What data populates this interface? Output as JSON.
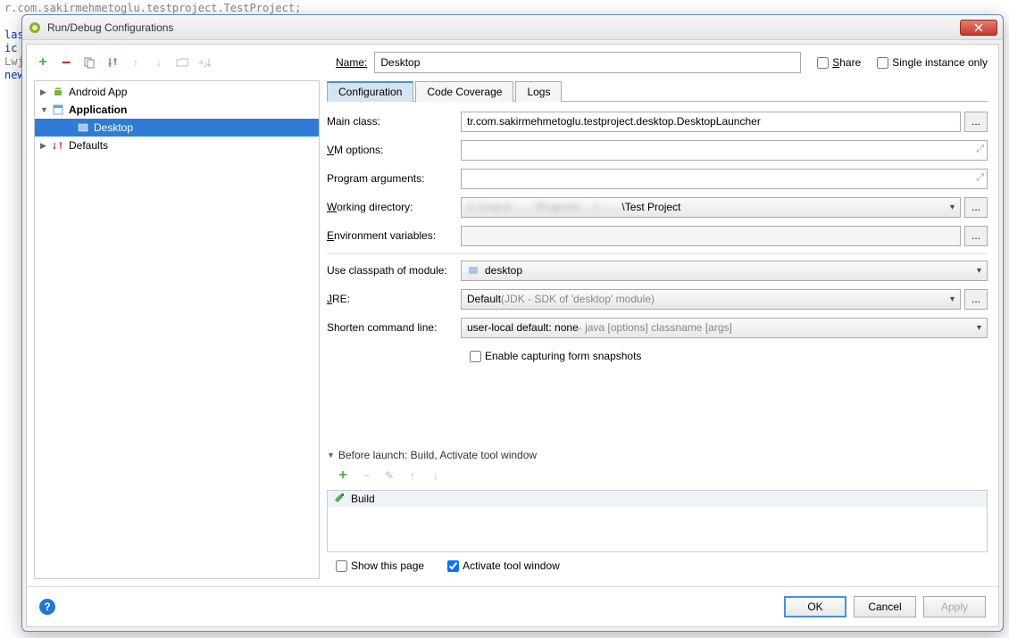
{
  "code_background": {
    "line1": "r.com.sakirmehmetoglu.testproject.TestProject;",
    "line2": "las",
    "line3": "ic",
    "line4": "Lwj",
    "line5": "new"
  },
  "dialog": {
    "title": "Run/Debug Configurations"
  },
  "toolbar": {
    "name_label": "Name:",
    "name_value": "Desktop",
    "share_label": "Share",
    "single_instance_label": "Single instance only"
  },
  "tree": {
    "android_app": "Android App",
    "application": "Application",
    "desktop": "Desktop",
    "defaults": "Defaults"
  },
  "tabs": {
    "configuration": "Configuration",
    "code_coverage": "Code Coverage",
    "logs": "Logs"
  },
  "form": {
    "main_class_label": "Main class:",
    "main_class_value": "tr.com.sakirmehmetoglu.testproject.desktop.DesktopLauncher",
    "vm_options_label": "VM options:",
    "vm_options_value": "",
    "program_args_label": "Program arguments:",
    "program_args_value": "",
    "working_dir_label": "Working directory:",
    "working_dir_value": "\\Test Project",
    "env_vars_label": "Environment variables:",
    "env_vars_value": "",
    "classpath_label": "Use classpath of module:",
    "classpath_value": "desktop",
    "jre_label": "JRE:",
    "jre_value": "Default",
    "jre_hint": " (JDK - SDK of 'desktop' module)",
    "shorten_label": "Shorten command line:",
    "shorten_value": "user-local default: none",
    "shorten_hint": " - java [options] classname [args]",
    "snapshots_label": "Enable capturing form snapshots"
  },
  "before_launch": {
    "header": "Before launch: Build, Activate tool window",
    "build_item": "Build"
  },
  "footer": {
    "show_page": "Show this page",
    "activate_window": "Activate tool window"
  },
  "buttons": {
    "ok": "OK",
    "cancel": "Cancel",
    "apply": "Apply"
  }
}
